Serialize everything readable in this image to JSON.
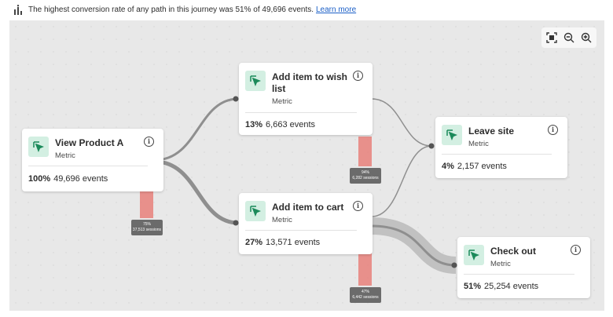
{
  "banner": {
    "text": "The highest conversion rate of any path in this journey was 51% of 49,696 events.",
    "link": "Learn more",
    "icon": "insight-chart-icon"
  },
  "zoom": {
    "fit_icon": "fit-to-screen-icon",
    "zoom_out_icon": "zoom-out-icon",
    "zoom_in_icon": "zoom-in-icon"
  },
  "colors": {
    "canvas_bg": "#e8e8e8",
    "flow": "#8f8f8f",
    "dropoff": "#e8807a",
    "icon_bg": "#d3efe2",
    "icon_fg": "#1b8a5a"
  },
  "nodes": {
    "view_product": {
      "title": "View Product A",
      "type": "Metric",
      "percent": "100%",
      "events": "49,696 events",
      "icon": "cursor-click-icon"
    },
    "wishlist": {
      "title_line1": "Add item to wish",
      "title_line2": "list",
      "type": "Metric",
      "percent": "13%",
      "events": "6,663 events",
      "icon": "cursor-click-icon"
    },
    "cart": {
      "title": "Add item to cart",
      "type": "Metric",
      "percent": "27%",
      "events": "13,571 events",
      "icon": "cursor-click-icon"
    },
    "leave": {
      "title": "Leave site",
      "type": "Metric",
      "percent": "4%",
      "events": "2,157 events",
      "icon": "cursor-click-icon"
    },
    "checkout": {
      "title": "Check out",
      "type": "Metric",
      "percent": "51%",
      "events": "25,254 events",
      "icon": "cursor-click-icon"
    }
  },
  "dropoffs": {
    "view_product": {
      "percent": "75%",
      "sessions": "37,513 sessions"
    },
    "wishlist": {
      "percent": "94%",
      "sessions": "6,282 sessions"
    },
    "cart": {
      "percent": "47%",
      "sessions": "6,442 sessions"
    }
  }
}
